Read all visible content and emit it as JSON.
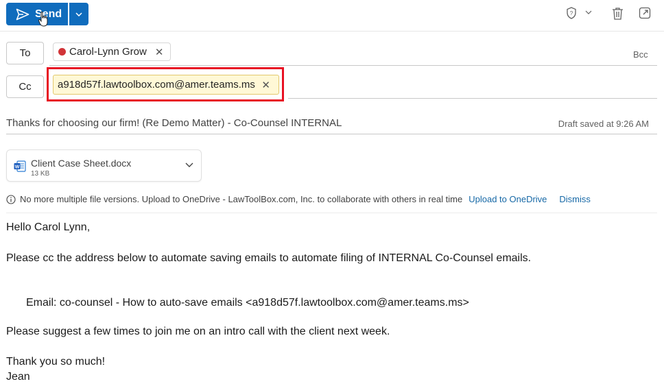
{
  "toolbar": {
    "send_label": "Send",
    "accent_color": "#0f6cbd",
    "icons": [
      "send-icon",
      "chevron-down-icon",
      "sensitivity-shield-icon",
      "chevron-down-icon",
      "delete-icon",
      "popout-icon"
    ]
  },
  "to": {
    "label": "To",
    "recipient": "Carol-Lynn Grow",
    "presence_color": "#d13438",
    "bcc_label": "Bcc"
  },
  "cc": {
    "label": "Cc",
    "recipient": "a918d57f.lawtoolbox.com@amer.teams.ms",
    "highlight_color": "#e81123"
  },
  "subject": {
    "text": "Thanks for choosing our firm! (Re Demo Matter) - Co-Counsel INTERNAL",
    "draft_status": "Draft saved at 9:26 AM"
  },
  "attachment": {
    "name": "Client Case Sheet.docx",
    "size": "13 KB"
  },
  "notice": {
    "text": "No more multiple file versions. Upload to OneDrive - LawToolBox.com, Inc. to collaborate with others in real time",
    "upload_link": "Upload to OneDrive",
    "dismiss_link": "Dismiss"
  },
  "body": {
    "greeting": "Hello Carol Lynn,",
    "paragraph1": "Please cc the address below to automate saving emails to automate filing of INTERNAL Co-Counsel emails.",
    "email_line": "Email: co-counsel - How to auto-save emails <a918d57f.lawtoolbox.com@amer.teams.ms>",
    "paragraph2": "Please suggest a few times to join me on an intro call with the client next week.",
    "closing": "Thank you so much!",
    "signature": "Jean"
  }
}
